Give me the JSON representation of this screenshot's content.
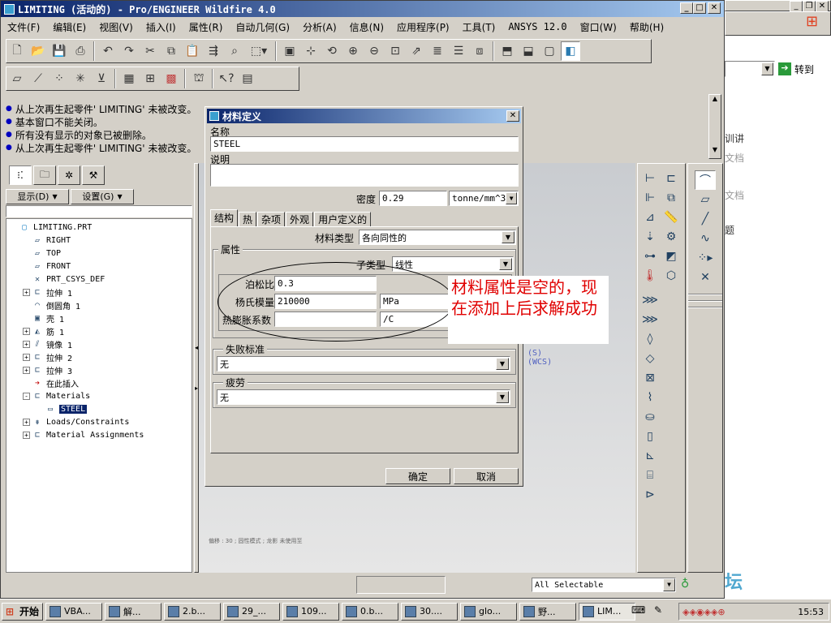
{
  "window": {
    "title": "LIMITING (活动的) - Pro/ENGINEER Wildfire 4.0"
  },
  "menu": [
    "文件(F)",
    "编辑(E)",
    "视图(V)",
    "插入(I)",
    "属性(R)",
    "自动几何(G)",
    "分析(A)",
    "信息(N)",
    "应用程序(P)",
    "工具(T)",
    "ANSYS 12.0",
    "窗口(W)",
    "帮助(H)"
  ],
  "toolbar1_icons": [
    "new-icon",
    "open-icon",
    "save-icon",
    "print-icon",
    "undo-icon",
    "redo-icon",
    "cut-icon",
    "copy-icon",
    "paste-icon",
    "regenerate-icon",
    "find-icon",
    "select-box-icon",
    "repaint-icon",
    "spin-center-icon",
    "orient-icon",
    "zoom-in-icon",
    "zoom-out-icon",
    "refit-icon",
    "saved-views-icon",
    "layers-icon",
    "model-tree-icon",
    "wireframe-icon",
    "hidden-line-icon",
    "no-hidden-icon",
    "shaded-icon"
  ],
  "messages": [
    "从上次再生起零件' LIMITING' 未被改变。",
    "基本窗口不能关闭。",
    "所有没有显示的对象已被删除。",
    "从上次再生起零件' LIMITING' 未被改变。"
  ],
  "left_panel": {
    "show_label": "显示(D)",
    "settings_label": "设置(G)"
  },
  "tree": [
    {
      "label": "LIMITING.PRT",
      "indent": 0,
      "expand": "",
      "icon": "part-icon"
    },
    {
      "label": "RIGHT",
      "indent": 1,
      "expand": "",
      "icon": "datum-plane-icon"
    },
    {
      "label": "TOP",
      "indent": 1,
      "expand": "",
      "icon": "datum-plane-icon"
    },
    {
      "label": "FRONT",
      "indent": 1,
      "expand": "",
      "icon": "datum-plane-icon"
    },
    {
      "label": "PRT_CSYS_DEF",
      "indent": 1,
      "expand": "",
      "icon": "csys-icon"
    },
    {
      "label": "拉伸 1",
      "indent": 1,
      "expand": "+",
      "icon": "extrude-icon"
    },
    {
      "label": "倒圆角 1",
      "indent": 1,
      "expand": "",
      "icon": "round-icon"
    },
    {
      "label": "壳 1",
      "indent": 1,
      "expand": "",
      "icon": "shell-icon"
    },
    {
      "label": "筋 1",
      "indent": 1,
      "expand": "+",
      "icon": "rib-icon"
    },
    {
      "label": "镜像 1",
      "indent": 1,
      "expand": "+",
      "icon": "mirror-icon"
    },
    {
      "label": "拉伸 2",
      "indent": 1,
      "expand": "+",
      "icon": "extrude-icon"
    },
    {
      "label": "拉伸 3",
      "indent": 1,
      "expand": "+",
      "icon": "extrude-icon"
    },
    {
      "label": "在此插入",
      "indent": 1,
      "expand": "",
      "icon": "insert-here-icon"
    },
    {
      "label": "Materials",
      "indent": 1,
      "expand": "-",
      "icon": "materials-icon"
    },
    {
      "label": "STEEL",
      "indent": 2,
      "expand": "",
      "icon": "material-icon",
      "selected": true
    },
    {
      "label": "Loads/Constraints",
      "indent": 1,
      "expand": "+",
      "icon": "loads-icon"
    },
    {
      "label": "Material Assignments",
      "indent": 1,
      "expand": "+",
      "icon": "material-assign-icon"
    }
  ],
  "dialog": {
    "title": "材料定义",
    "name_label": "名称",
    "name_value": "STEEL",
    "desc_label": "说明",
    "desc_value": "",
    "density_label": "密度",
    "density_value": "0.29",
    "density_unit": "tonne/mm^3",
    "tabs": [
      "结构",
      "热",
      "杂项",
      "外观",
      "用户定义的"
    ],
    "material_type_label": "材料类型",
    "material_type_value": "各向同性的",
    "props_group": "属性",
    "subtype_label": "子类型",
    "subtype_value": "线性",
    "poisson_label": "泊松比",
    "poisson_value": "0.3",
    "young_label": "杨氏模量",
    "young_value": "210000",
    "young_unit": "MPa",
    "thermal_label": "热膨胀系数",
    "thermal_value": "",
    "thermal_unit": "/C",
    "failure_group": "失败标准",
    "failure_value": "无",
    "fatigue_group": "疲劳",
    "fatigue_value": "无",
    "ok_label": "确定",
    "cancel_label": "取消"
  },
  "annotation": {
    "text": "材料属性是空的，现在添加上后求解成功",
    "color": "#e00000"
  },
  "graphics": {
    "csys_labels": [
      "(S)",
      "(WCS)"
    ],
    "bottom_text": "偏移 : 30 ; 固性模式 ; 龙影 未使用至"
  },
  "statusbar": {
    "filter": "All Selectable"
  },
  "bg_window": {
    "goto_label": "转到",
    "side_texts": [
      "训讲",
      "文档",
      "文档",
      "题"
    ]
  },
  "watermark": "野火论坛",
  "taskbar": {
    "start": "开始",
    "tasks": [
      "VBA...",
      "解...",
      "2.b...",
      "29_...",
      "109...",
      "0.b...",
      "30....",
      "glo...",
      "野...",
      "LIM..."
    ],
    "clock": "15:53"
  }
}
